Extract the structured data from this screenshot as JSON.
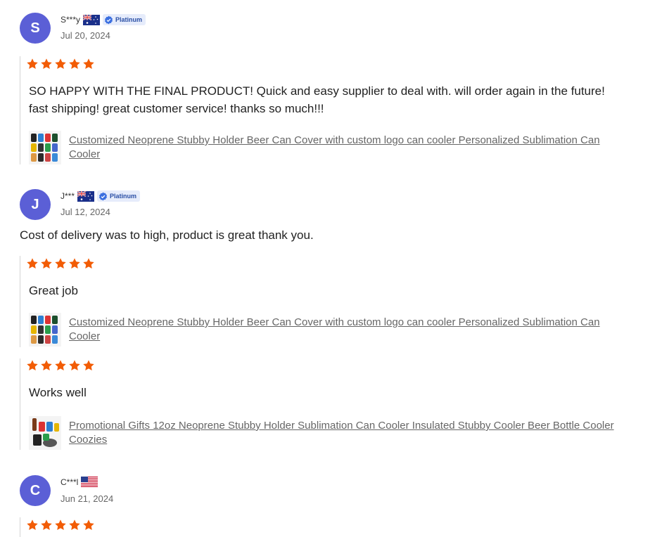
{
  "reviews": [
    {
      "avatar_letter": "S",
      "username": "S***y",
      "country": "Australia",
      "badge": "Platinum",
      "date": "Jul 20, 2024",
      "feedback": [
        {
          "rating": 5,
          "text": "SO HAPPY WITH THE FINAL PRODUCT! Quick and easy supplier to deal with. will order again in the future! fast shipping! great customer service! thanks so much!!!",
          "product": "Customized Neoprene Stubby Holder Beer Can Cover with custom logo can cooler Personalized Sublimation Can Cooler"
        }
      ]
    },
    {
      "avatar_letter": "J",
      "username": "J***",
      "country": "Australia",
      "badge": "Platinum",
      "date": "Jul 12, 2024",
      "comment": "Cost of delivery was to high, product is great thank you.",
      "feedback": [
        {
          "rating": 5,
          "text": "Great job",
          "product": "Customized Neoprene Stubby Holder Beer Can Cover with custom logo can cooler Personalized Sublimation Can Cooler"
        },
        {
          "rating": 5,
          "text": "Works well",
          "product": "Promotional Gifts 12oz Neoprene Stubby Holder Sublimation Can Cooler Insulated Stubby Cooler Beer Bottle Cooler Coozies"
        }
      ]
    },
    {
      "avatar_letter": "C",
      "username": "C***l",
      "country": "United States",
      "date": "Jun 21, 2024",
      "feedback": [
        {
          "rating": 5
        }
      ]
    }
  ],
  "colors": {
    "avatar": "#5b5fd6",
    "star": "#f25c05",
    "badge_bg": "#e6ecfb",
    "badge_text": "#2a4fa5"
  },
  "icons": {
    "star": "star-icon",
    "verified": "verified-badge-icon",
    "flag_au": "flag-australia-icon",
    "flag_us": "flag-usa-icon"
  }
}
